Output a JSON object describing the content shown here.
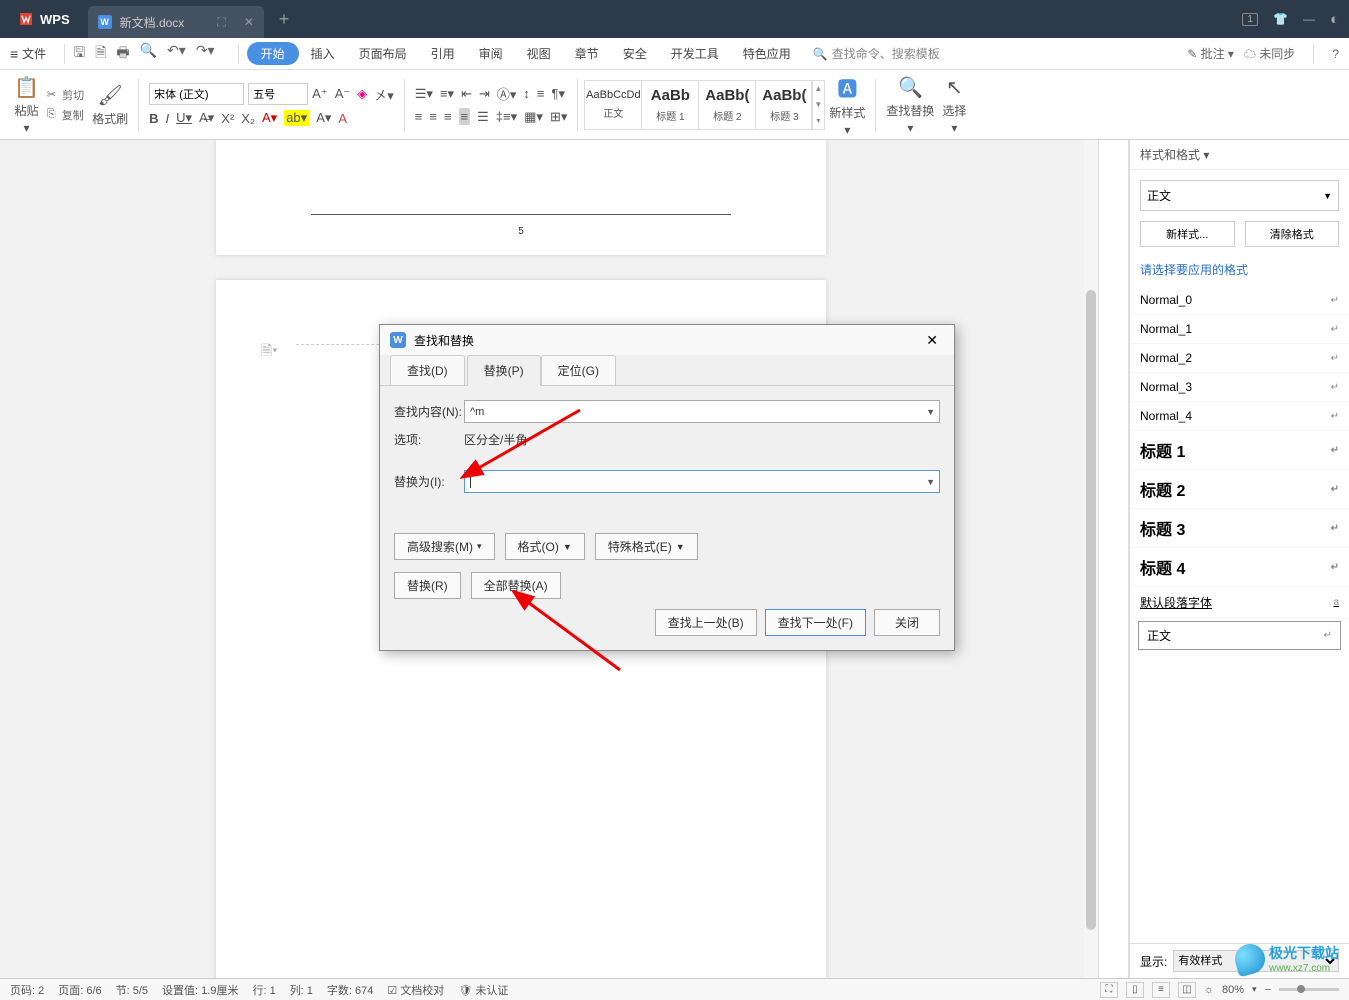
{
  "titlebar": {
    "app_name": "WPS",
    "doc_tab": "新文档.docx",
    "badge": "1"
  },
  "menubar": {
    "file": "文件",
    "tabs": [
      "开始",
      "插入",
      "页面布局",
      "引用",
      "审阅",
      "视图",
      "章节",
      "安全",
      "开发工具",
      "特色应用"
    ],
    "active_tab": 0,
    "search_placeholder": "查找命令、搜索模板",
    "right": {
      "annotate": "批注",
      "sync": "未同步"
    }
  },
  "ribbon": {
    "paste": "粘贴",
    "cut": "剪切",
    "copy": "复制",
    "format_painter": "格式刷",
    "font_name": "宋体 (正文)",
    "font_size": "五号",
    "styles": [
      {
        "preview": "AaBbCcDd",
        "name": "正文"
      },
      {
        "preview": "AaBb",
        "name": "标题 1"
      },
      {
        "preview": "AaBb(",
        "name": "标题 2"
      },
      {
        "preview": "AaBb(",
        "name": "标题 3"
      }
    ],
    "new_style": "新样式",
    "find_replace": "查找替换",
    "select": "选择"
  },
  "dialog": {
    "title": "查找和替换",
    "tabs": {
      "find": "查找(D)",
      "replace": "替换(P)",
      "goto": "定位(G)"
    },
    "find_label": "查找内容(N):",
    "find_value": "^m",
    "options_label": "选项:",
    "options_value": "区分全/半角",
    "replace_label": "替换为(I):",
    "replace_value": "",
    "adv_search": "高级搜索(M)",
    "format": "格式(O)",
    "special": "特殊格式(E)",
    "replace_btn": "替换(R)",
    "replace_all": "全部替换(A)",
    "find_prev": "查找上一处(B)",
    "find_next": "查找下一处(F)",
    "close": "关闭"
  },
  "styles_panel": {
    "header": "样式和格式",
    "current": "正文",
    "new_style": "新样式...",
    "clear_format": "清除格式",
    "hint": "请选择要应用的格式",
    "items": [
      {
        "label": "Normal_0",
        "bold": false
      },
      {
        "label": "Normal_1",
        "bold": false
      },
      {
        "label": "Normal_2",
        "bold": false
      },
      {
        "label": "Normal_3",
        "bold": false
      },
      {
        "label": "Normal_4",
        "bold": false
      },
      {
        "label": "标题 1",
        "bold": true
      },
      {
        "label": "标题 2",
        "bold": true
      },
      {
        "label": "标题 3",
        "bold": true
      },
      {
        "label": "标题 4",
        "bold": true
      }
    ],
    "default_font": "默认段落字体",
    "selected": "正文",
    "show_label": "显示:",
    "show_value": "有效样式"
  },
  "page": {
    "number": "5"
  },
  "statusbar": {
    "page_no": "页码: 2",
    "page": "页面: 6/6",
    "section": "节: 5/5",
    "set_value": "设置值: 1.9厘米",
    "row": "行: 1",
    "col": "列: 1",
    "chars": "字数: 674",
    "proof": "文档校对",
    "unauth": "未认证",
    "zoom": "80%"
  },
  "watermark": {
    "name": "极光下载站",
    "url": "www.xz7.com"
  }
}
